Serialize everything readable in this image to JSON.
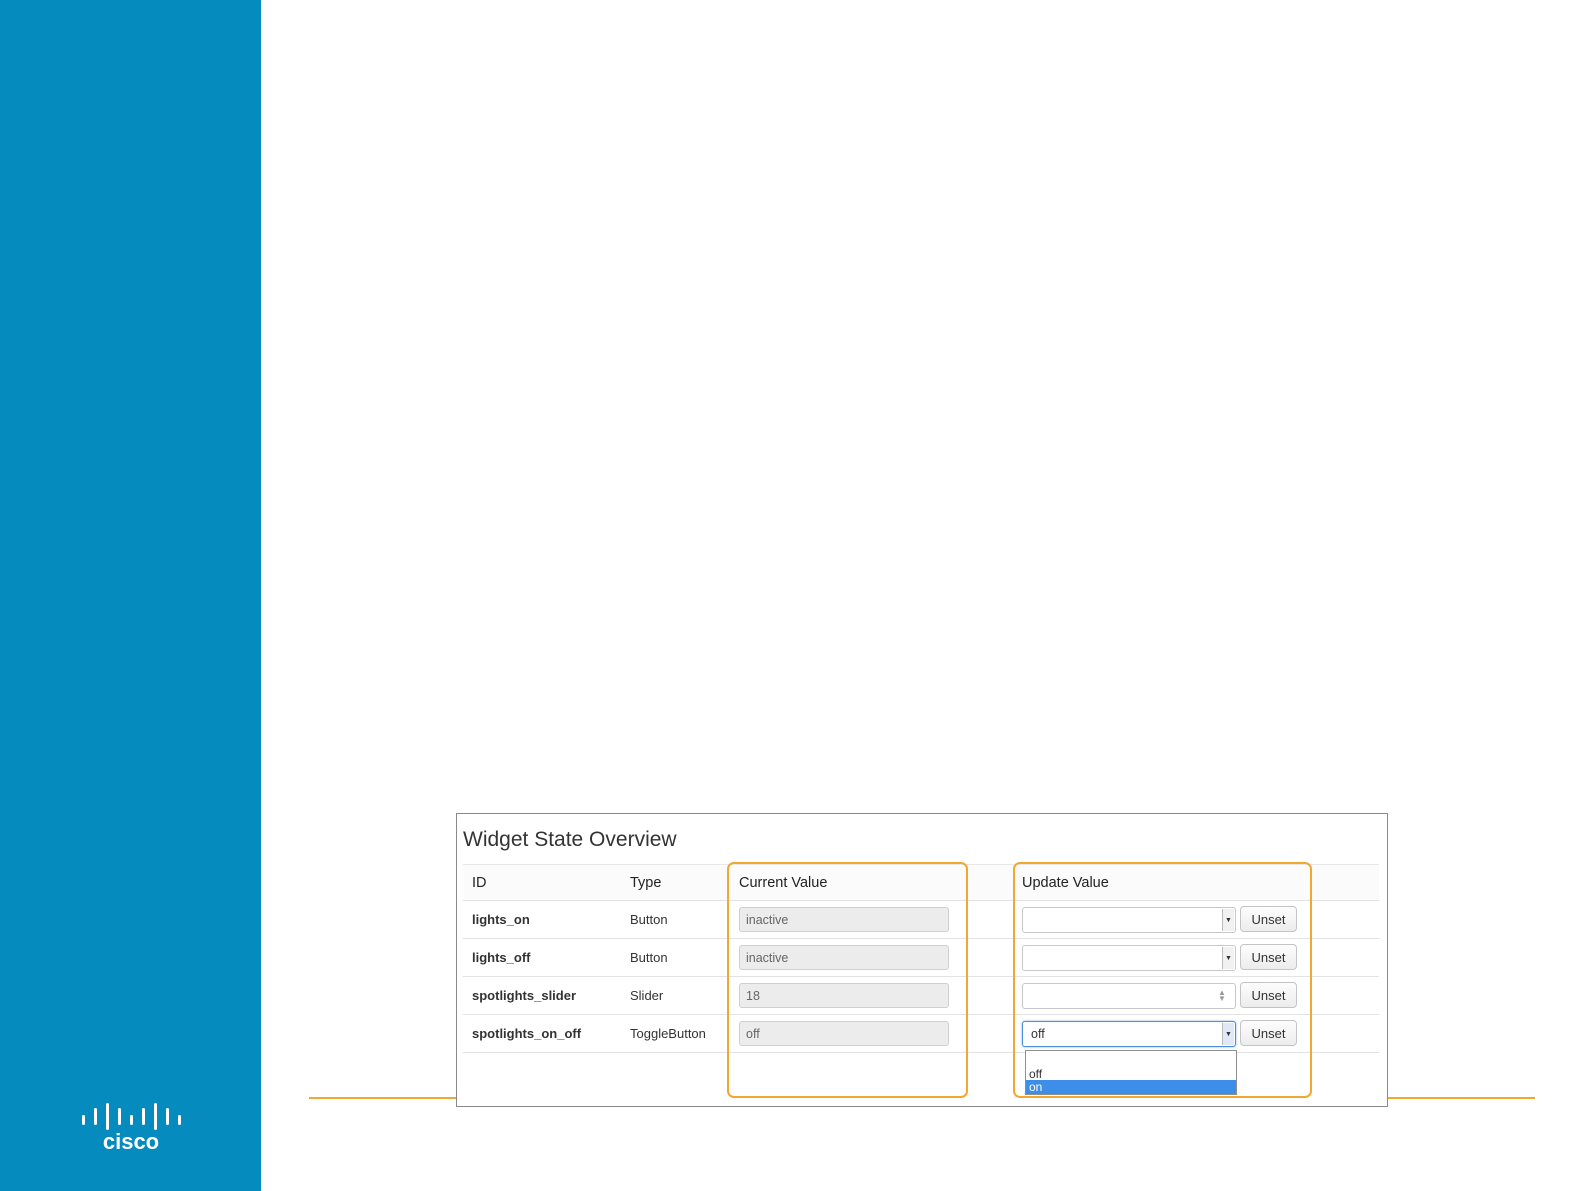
{
  "panel": {
    "title": "Widget State Overview",
    "columns": {
      "id": "ID",
      "type": "Type",
      "current": "Current Value",
      "update": "Update Value"
    },
    "rows": [
      {
        "id": "lights_on",
        "type": "Button",
        "current": "inactive",
        "update": "",
        "control": "select",
        "unset": "Unset"
      },
      {
        "id": "lights_off",
        "type": "Button",
        "current": "inactive",
        "update": "",
        "control": "select",
        "unset": "Unset"
      },
      {
        "id": "spotlights_slider",
        "type": "Slider",
        "current": "18",
        "update": "",
        "control": "number",
        "unset": "Unset"
      },
      {
        "id": "spotlights_on_off",
        "type": "ToggleButton",
        "current": "off",
        "update": "off",
        "control": "select",
        "unset": "Unset"
      }
    ],
    "dropdown": {
      "options": [
        "off",
        "on"
      ],
      "highlighted": "on"
    }
  },
  "brand": {
    "logo": "cisco",
    "sidebar_color": "#058bbe",
    "highlight_color": "#f0a830",
    "selection_color": "#3d8ee8"
  }
}
